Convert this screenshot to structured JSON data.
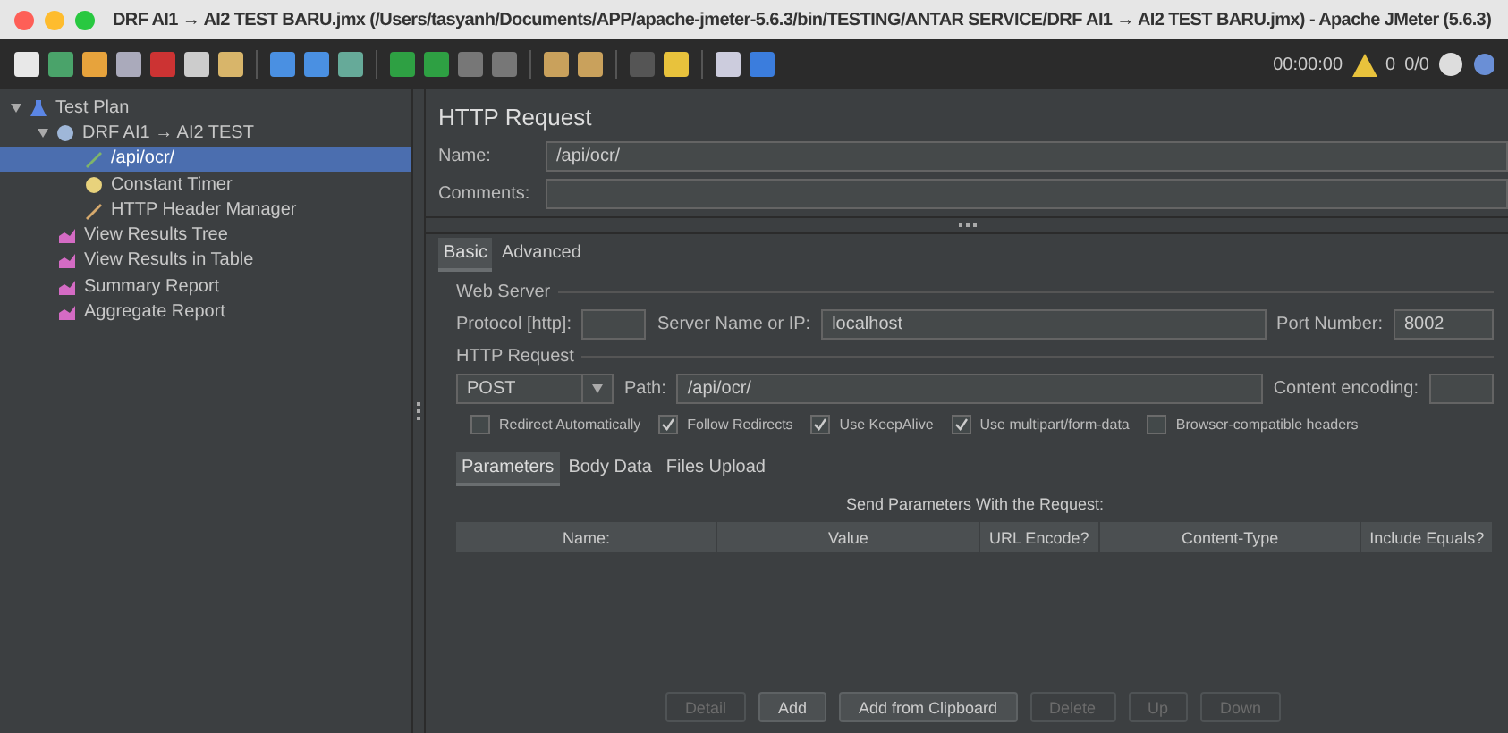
{
  "window": {
    "title": "DRF AI1 → AI2 TEST BARU.jmx (/Users/tasyanh/Documents/APP/apache-jmeter-5.6.3/bin/TESTING/ANTAR SERVICE/DRF AI1 → AI2 TEST BARU.jmx) - Apache JMeter (5.6.3)"
  },
  "toolbar": {
    "timer": "00:00:00",
    "warnings": "0",
    "threads": "0/0"
  },
  "tree": [
    {
      "label": "Test Plan",
      "kind": "plan",
      "expanded": true,
      "selected": false,
      "children": [
        {
          "label": "DRF AI1 → AI2 TEST",
          "kind": "group",
          "expanded": true,
          "selected": false,
          "children": [
            {
              "label": "/api/ocr/",
              "kind": "sampler",
              "selected": true
            },
            {
              "label": "Constant Timer",
              "kind": "timer",
              "selected": false
            },
            {
              "label": "HTTP Header Manager",
              "kind": "config",
              "selected": false
            }
          ]
        },
        {
          "label": "View Results Tree",
          "kind": "listener",
          "selected": false
        },
        {
          "label": "View Results in Table",
          "kind": "listener",
          "selected": false
        },
        {
          "label": "Summary Report",
          "kind": "listener",
          "selected": false
        },
        {
          "label": "Aggregate Report",
          "kind": "listener",
          "selected": false
        }
      ]
    }
  ],
  "panel": {
    "title": "HTTP Request",
    "name_label": "Name:",
    "name": "/api/ocr/",
    "comments_label": "Comments:",
    "tabs": [
      {
        "label": "Basic",
        "selected": true
      },
      {
        "label": "Advanced",
        "selected": false
      }
    ],
    "web_server": {
      "legend": "Web Server",
      "protocol_label": "Protocol [http]:",
      "server_label": "Server Name or IP:",
      "server": "localhost",
      "port_label": "Port Number:",
      "port": "8002"
    },
    "http_request": {
      "legend": "HTTP Request",
      "method": "POST",
      "path_label": "Path:",
      "path": "/api/ocr/",
      "encoding_label": "Content encoding:"
    },
    "options": [
      {
        "label": "Redirect Automatically",
        "checked": false
      },
      {
        "label": "Follow Redirects",
        "checked": true
      },
      {
        "label": "Use KeepAlive",
        "checked": true
      },
      {
        "label": "Use multipart/form-data",
        "checked": true
      },
      {
        "label": "Browser-compatible headers",
        "checked": false
      }
    ],
    "sub_tabs": [
      {
        "label": "Parameters",
        "selected": true
      },
      {
        "label": "Body Data",
        "selected": false
      },
      {
        "label": "Files Upload",
        "selected": false
      }
    ],
    "table_title": "Send Parameters With the Request:",
    "columns": [
      "Name:",
      "Value",
      "URL Encode?",
      "Content-Type",
      "Include Equals?"
    ],
    "buttons": [
      {
        "label": "Detail",
        "disabled": true
      },
      {
        "label": "Add",
        "disabled": false
      },
      {
        "label": "Add from Clipboard",
        "disabled": false
      },
      {
        "label": "Delete",
        "disabled": true
      },
      {
        "label": "Up",
        "disabled": true
      },
      {
        "label": "Down",
        "disabled": true
      }
    ]
  }
}
